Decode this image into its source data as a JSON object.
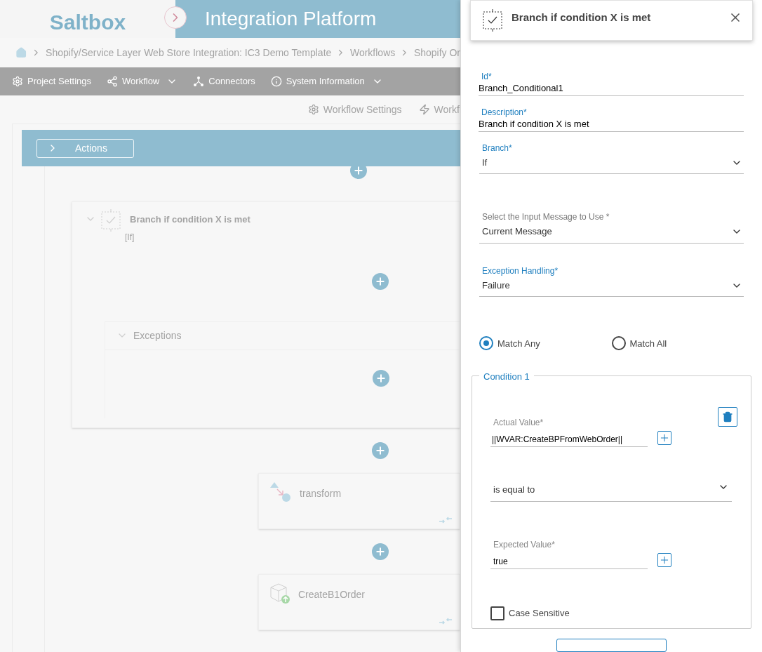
{
  "header": {
    "logo": "Saltbox",
    "title": "Integration Platform"
  },
  "breadcrumbs": [
    "Shopify/Service Layer Web Store Integration: IC3 Demo Template",
    "Workflows",
    "Shopify Or"
  ],
  "toolbar": [
    {
      "label": "Project Settings",
      "kind": "settings",
      "dropdown": false
    },
    {
      "label": "Workflow",
      "kind": "share",
      "dropdown": true
    },
    {
      "label": "Connectors",
      "kind": "connectors",
      "dropdown": false
    },
    {
      "label": "System Information",
      "kind": "info",
      "dropdown": true
    }
  ],
  "subtoolbar": [
    {
      "label": "Workflow Settings",
      "kind": "settings"
    },
    {
      "label": "Workfl",
      "kind": "bolt"
    }
  ],
  "actions_button": "Actions",
  "canvas": {
    "branch": {
      "title": "Branch if condition X is met",
      "tag": "[If]",
      "exceptions": "Exceptions"
    },
    "steps": [
      {
        "name": "transform",
        "kind": "transform"
      },
      {
        "name": "CreateB1Order",
        "kind": "create"
      }
    ]
  },
  "panel": {
    "title": "Branch if condition X is met",
    "fields": [
      {
        "kind": "text",
        "label": "Id*",
        "value": "Branch_Conditional1",
        "accent": true
      },
      {
        "kind": "text",
        "label": "Description*",
        "value": "Branch if condition X is met",
        "accent": true
      },
      {
        "kind": "select",
        "label": "Branch*",
        "value": "If",
        "accent": true
      },
      {
        "kind": "select",
        "label": "Select the Input Message to Use *",
        "value": "Current Message",
        "accent": false
      },
      {
        "kind": "select",
        "label": "Exception Handling*",
        "value": "Failure",
        "accent": true
      }
    ],
    "match_options": [
      {
        "label": "Match Any",
        "selected": true
      },
      {
        "label": "Match All",
        "selected": false
      }
    ],
    "condition": {
      "legend": "Condition 1",
      "actual": {
        "label": "Actual Value*",
        "value": "||WVAR:CreateBPFromWebOrder||"
      },
      "operator": "is equal to",
      "expected": {
        "label": "Expected Value*",
        "value": "true"
      },
      "case_sensitive": {
        "label": "Case Sensitive",
        "checked": false
      }
    }
  }
}
